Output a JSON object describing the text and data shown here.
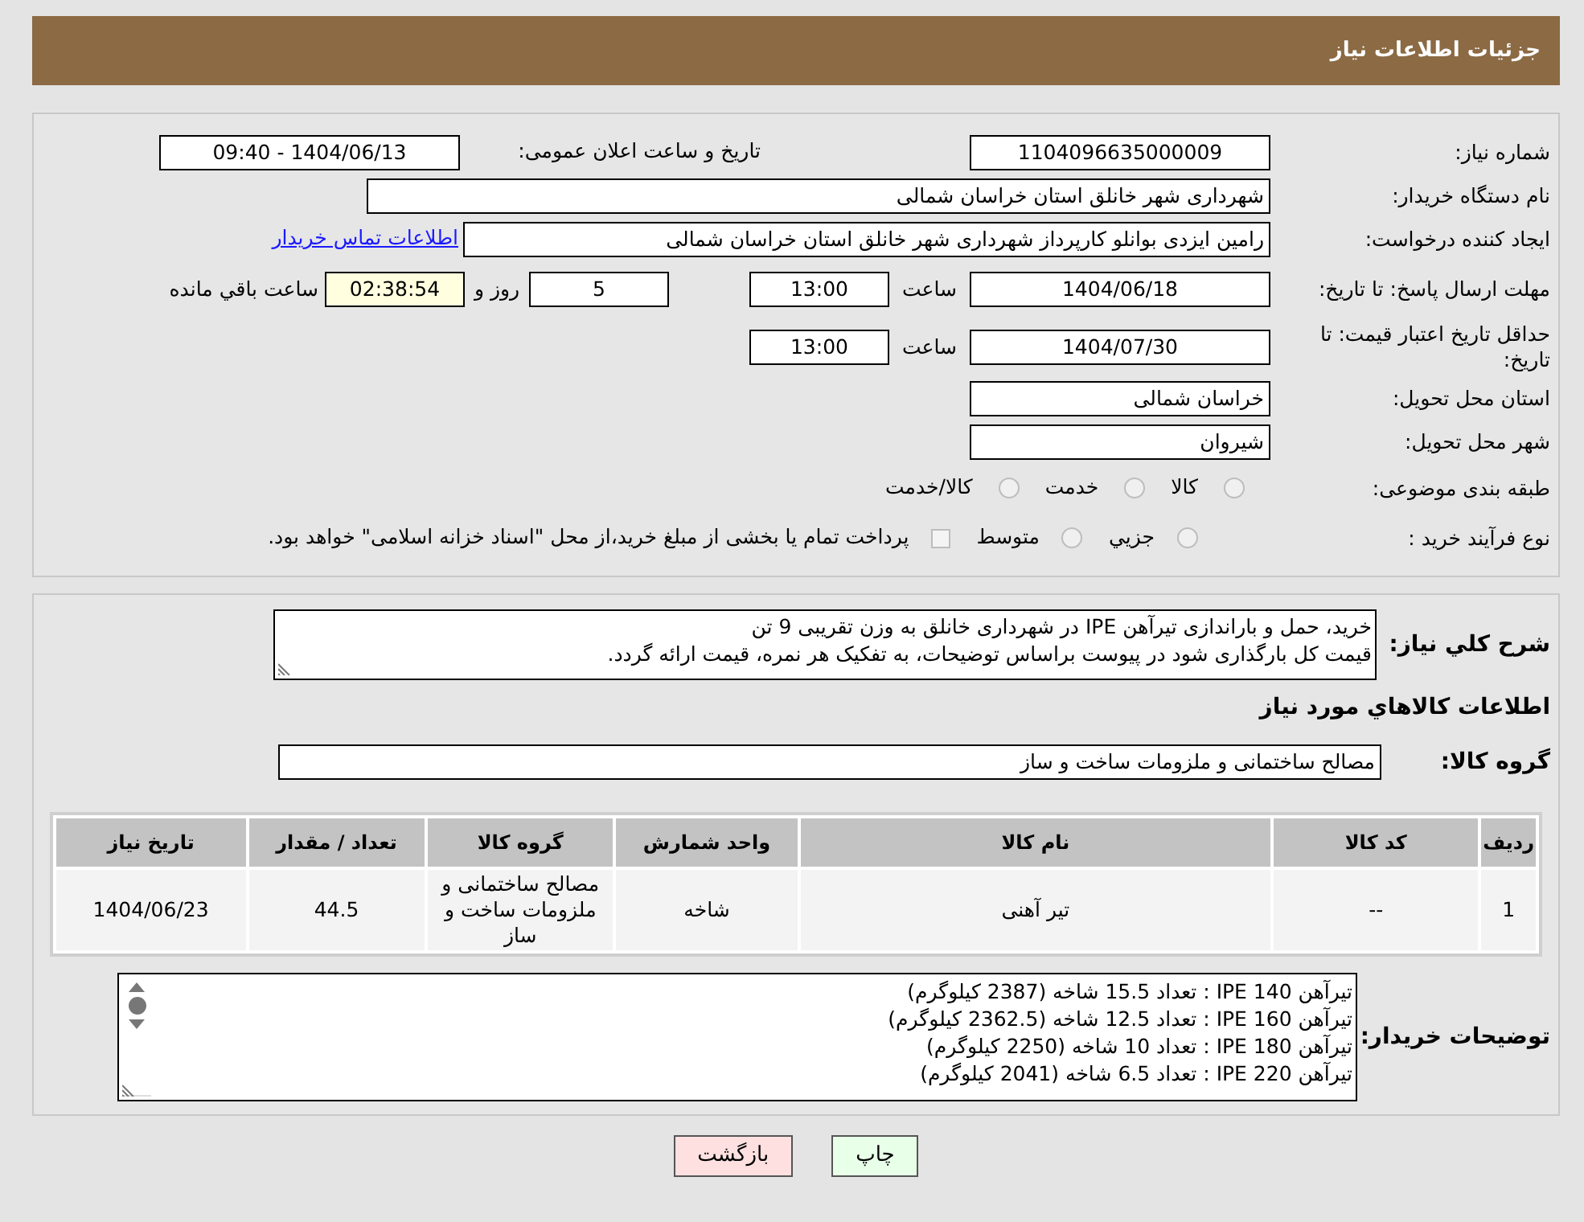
{
  "header": {
    "title": "جزئیات اطلاعات نیاز"
  },
  "need_number": {
    "label": "شماره نیاز:",
    "value": "1104096635000009"
  },
  "announce": {
    "label": "تاریخ و ساعت اعلان عمومی:",
    "value": "1404/06/13 - 09:40"
  },
  "buyer_org": {
    "label": "نام دستگاه خریدار:",
    "value": "شهرداری شهر خانلق استان خراسان شمالی"
  },
  "requester": {
    "label": "ایجاد کننده درخواست:",
    "value": "رامین ایزدی بوانلو کارپرداز شهرداری شهر خانلق استان خراسان شمالی",
    "link": "اطلاعات تماس خریدار"
  },
  "reply_deadline": {
    "label": "مهلت ارسال پاسخ: تا تاریخ:",
    "date": "1404/06/18",
    "time_label": "ساعت",
    "time": "13:00",
    "days": "5",
    "days_label": "روز و",
    "remaining": "02:38:54",
    "remaining_label": "ساعت باقي مانده"
  },
  "price_validity": {
    "label": "حداقل تاریخ اعتبار قیمت: تا تاریخ:",
    "date": "1404/07/30",
    "time_label": "ساعت",
    "time": "13:00"
  },
  "province": {
    "label": "استان محل تحویل:",
    "value": "خراسان شمالی"
  },
  "city": {
    "label": "شهر محل تحویل:",
    "value": "شیروان"
  },
  "category": {
    "label": "طبقه بندی موضوعی:",
    "options": [
      {
        "label": "کالا",
        "selected": false
      },
      {
        "label": "خدمت",
        "selected": false
      },
      {
        "label": "کالا/خدمت",
        "selected": false
      }
    ]
  },
  "process": {
    "label": "نوع فرآیند خرید :",
    "options": [
      {
        "kind": "radio",
        "label": "جزيي",
        "selected": false
      },
      {
        "kind": "radio",
        "label": "متوسط",
        "selected": false
      },
      {
        "kind": "checkbox",
        "label": "پرداخت تمام یا بخشی از مبلغ خرید،از محل \"اسناد خزانه اسلامی\" خواهد بود.",
        "checked": false
      }
    ]
  },
  "description": {
    "label": "شرح کلي نیاز:",
    "lines": [
      "خرید، حمل و باراندازی تیرآهن IPE در شهرداری خانلق به وزن تقریبی 9 تن",
      "قیمت کل بارگذاری شود در پیوست براساس توضیحات، به تفکیک هر نمره، قیمت ارائه گردد."
    ]
  },
  "goods_section": {
    "title": "اطلاعات کالاهاي مورد نياز"
  },
  "goods_group": {
    "label": "گروه کالا:",
    "value": "مصالح ساختمانی و ملزومات ساخت و ساز"
  },
  "table": {
    "columns": [
      "ردیف",
      "کد کالا",
      "نام کالا",
      "واحد شمارش",
      "گروه کالا",
      "تعداد / مقدار",
      "تاریخ نیاز"
    ],
    "rows": [
      [
        "1",
        "--",
        "تیر آهنی",
        "شاخه",
        "مصالح ساختمانی و ملزومات ساخت و ساز",
        "44.5",
        "1404/06/23"
      ]
    ]
  },
  "buyer_notes": {
    "label": "توضیحات خریدار:",
    "lines": [
      "تیرآهن IPE 140 : تعداد 15.5 شاخه (2387 کیلوگرم)",
      "تیرآهن IPE 160 : تعداد 12.5 شاخه (2362.5 کیلوگرم)",
      "تیرآهن IPE 180 : تعداد 10 شاخه (2250 کیلوگرم)",
      "تیرآهن IPE 220 : تعداد 6.5 شاخه (2041 کیلوگرم)"
    ]
  },
  "buttons": [
    {
      "kind": "print",
      "label": "چاپ"
    },
    {
      "kind": "back",
      "label": "بازگشت"
    }
  ]
}
